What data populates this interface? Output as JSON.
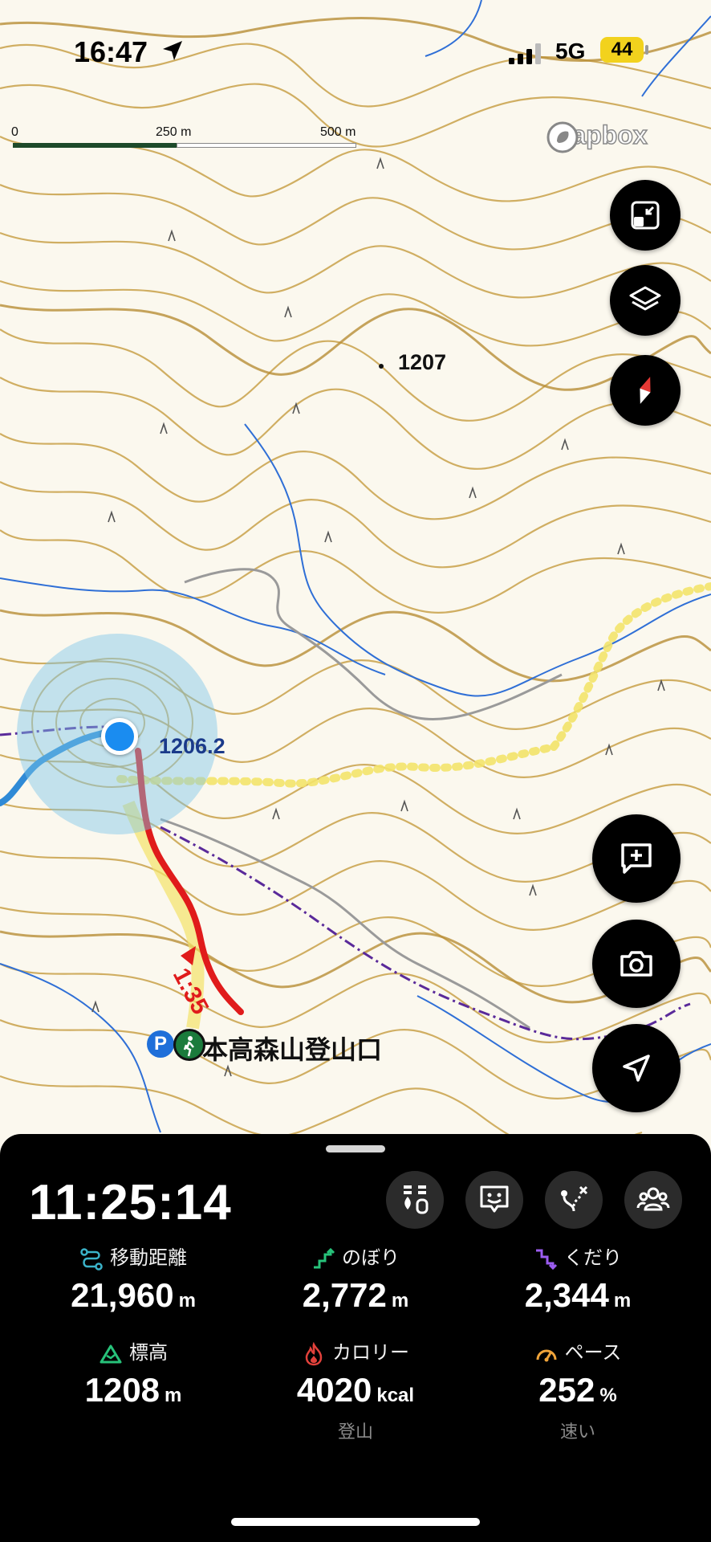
{
  "status_bar": {
    "time": "16:47",
    "network": "5G",
    "battery": "44"
  },
  "map": {
    "scale": {
      "labels": [
        "0",
        "250 m",
        "500 m"
      ]
    },
    "attribution": "mapbox",
    "elevation_labels": [
      "1207",
      "1206.2"
    ],
    "route_time_label": "1:35",
    "trailhead_label": "本高森山登山口",
    "parking_badge": "P",
    "colors": {
      "contour": "#c9a24a",
      "stream": "#2f6fd6",
      "route_red": "#e01b1b",
      "track_blue": "#2f8ad6",
      "highlight_yellow": "#f3e36a"
    }
  },
  "map_buttons": {
    "zoom_fit_icon": "minimize-icon",
    "layers_icon": "layers-icon",
    "compass_icon": "compass-icon",
    "add_note_icon": "add-note-icon",
    "camera_icon": "camera-icon",
    "locate_icon": "navigation-arrow-icon"
  },
  "panel": {
    "elapsed": "11:25:14",
    "tools": [
      "waypoint-tool-icon",
      "message-icon",
      "route-edit-icon",
      "group-icon"
    ],
    "stats": [
      {
        "title": "移動距離",
        "value": "21,960",
        "unit": "m",
        "icon": "distance-icon",
        "color": "#3bb3c9"
      },
      {
        "title": "のぼり",
        "value": "2,772",
        "unit": "m",
        "icon": "ascent-icon",
        "color": "#27c27a"
      },
      {
        "title": "くだり",
        "value": "2,344",
        "unit": "m",
        "icon": "descent-icon",
        "color": "#9b5cf0"
      },
      {
        "title": "標高",
        "value": "1208",
        "unit": "m",
        "icon": "mountain-icon",
        "color": "#27c27a"
      },
      {
        "title": "カロリー",
        "value": "4020",
        "unit": "kcal",
        "icon": "flame-icon",
        "color": "#e2413b"
      },
      {
        "title": "ペース",
        "value": "252",
        "unit": "%",
        "icon": "speedometer-icon",
        "color": "#f0a43a"
      }
    ],
    "sub_labels": {
      "calories": "登山",
      "pace": "速い"
    }
  }
}
